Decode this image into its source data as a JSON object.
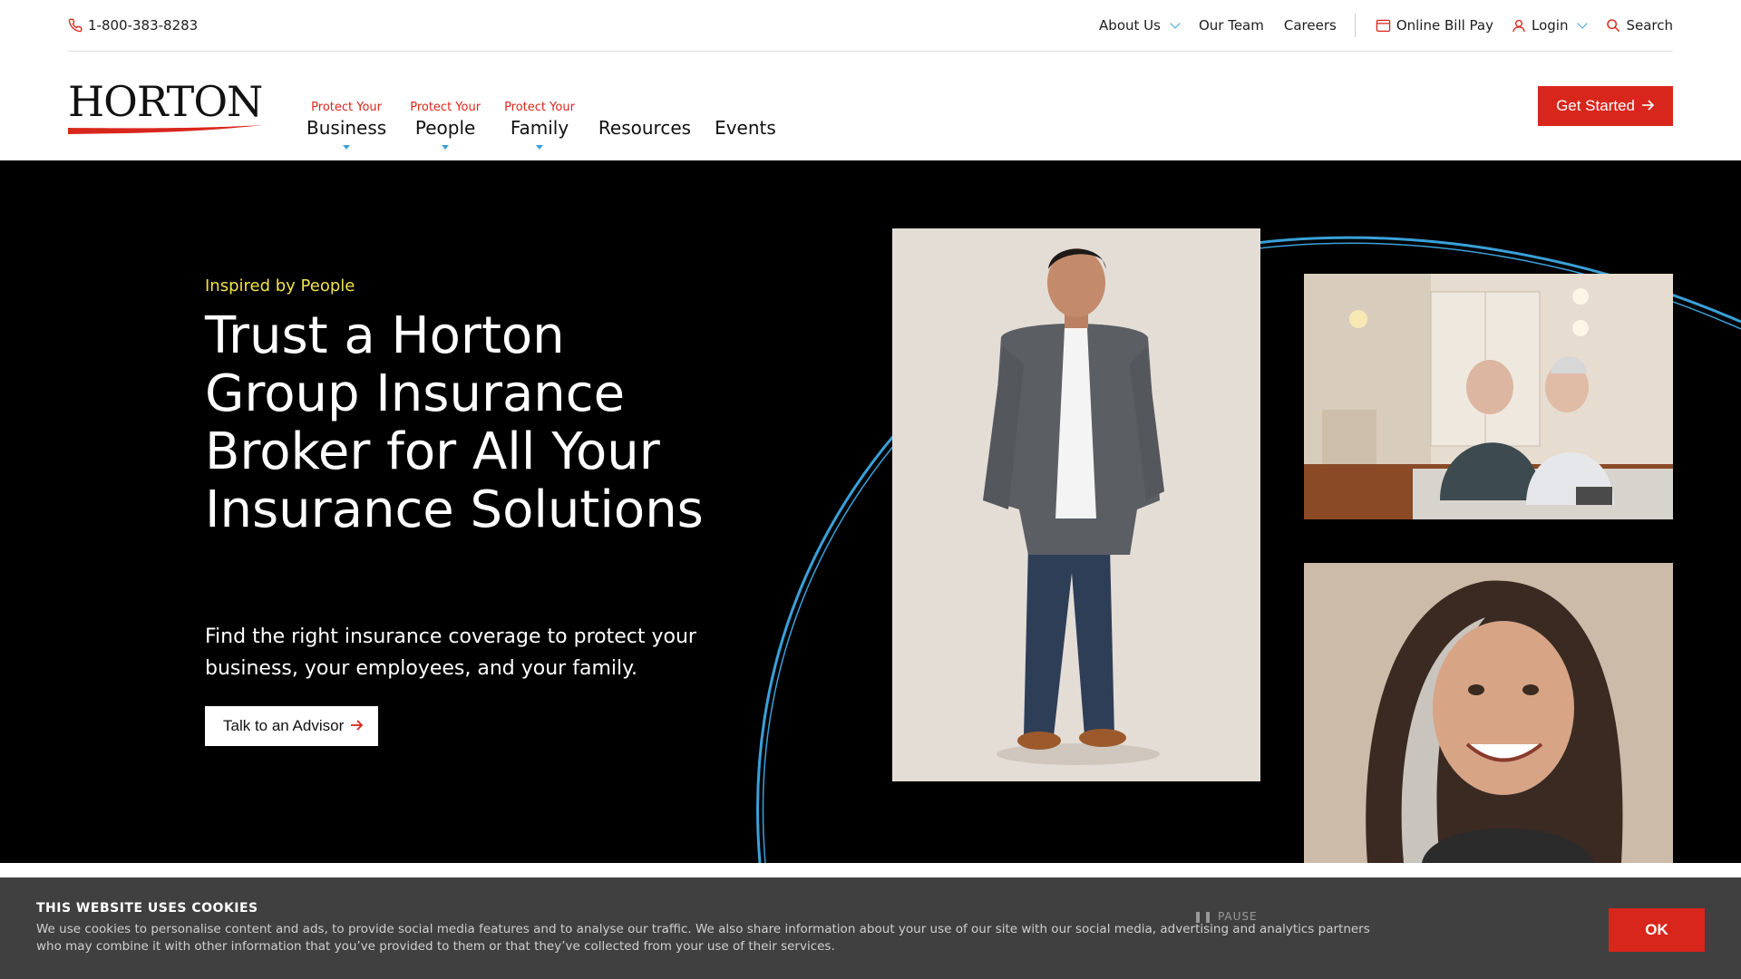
{
  "utility": {
    "phone": "1-800-383-8283",
    "links": [
      {
        "label": "About Us",
        "has_dropdown": true
      },
      {
        "label": "Our Team",
        "has_dropdown": false
      },
      {
        "label": "Careers",
        "has_dropdown": false
      }
    ],
    "bill_pay": "Online Bill Pay",
    "login": "Login",
    "search": "Search"
  },
  "brand": {
    "logo_text": "HORTON",
    "accent": "#d9261c",
    "highlight": "#3aa1d9"
  },
  "nav": {
    "items": [
      {
        "kicker": "Protect Your",
        "label": "Business"
      },
      {
        "kicker": "Protect Your",
        "label": "People"
      },
      {
        "kicker": "Protect Your",
        "label": "Family"
      },
      {
        "kicker": "",
        "label": "Resources"
      },
      {
        "kicker": "",
        "label": "Events"
      }
    ],
    "cta": "Get Started"
  },
  "hero": {
    "kicker": "Inspired by People",
    "title": "Trust a Horton Group Insurance Broker for All Your Insurance Solutions",
    "subtitle": "Find the right insurance coverage to protect your business, your employees, and your family.",
    "button": "Talk to an Advisor"
  },
  "cookie": {
    "title": "THIS WEBSITE USES COOKIES",
    "text": "We use cookies to personalise content and ads, to provide social media features and to analyse our traffic. We also share information about your use of our site with our social media, advertising and analytics partners who may combine it with other information that you’ve provided to them or that they’ve collected from your use of their services.",
    "ok": "OK",
    "pause": "PAUSE"
  }
}
